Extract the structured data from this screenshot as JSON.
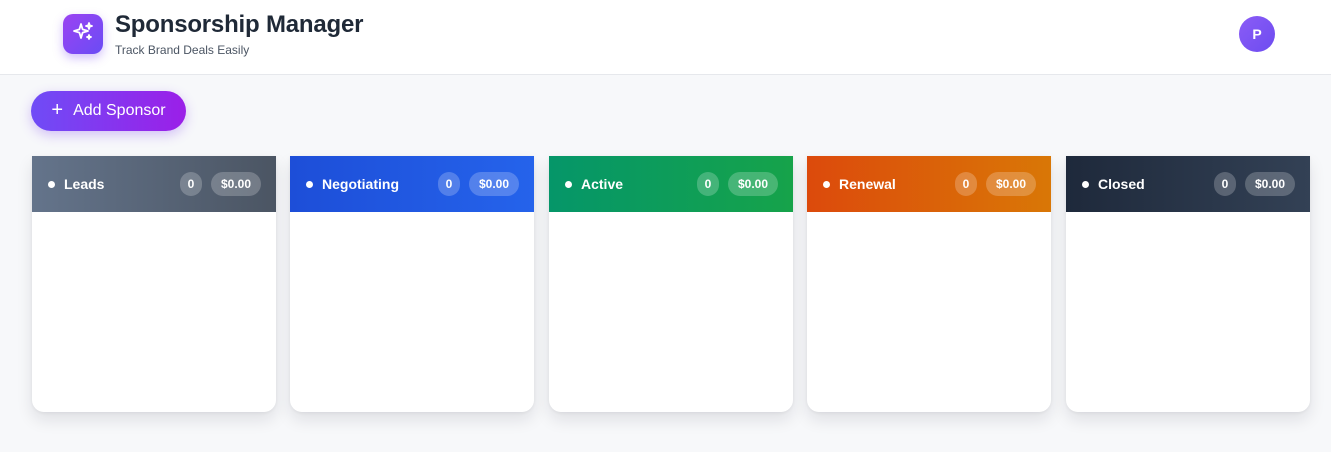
{
  "header": {
    "title": "Sponsorship Manager",
    "subtitle": "Track Brand Deals Easily",
    "logo_icon": "sparkles-icon",
    "avatar_initial": "P"
  },
  "toolbar": {
    "add_label": "Add Sponsor",
    "add_icon": "plus-icon"
  },
  "columns": [
    {
      "id": "leads",
      "title": "Leads",
      "count": "0",
      "total": "$0.00",
      "gradient": [
        "#4b5563",
        "#64748b"
      ]
    },
    {
      "id": "negotiating",
      "title": "Negotiating",
      "count": "0",
      "total": "$0.00",
      "gradient": [
        "#2563eb",
        "#1d4ed8"
      ]
    },
    {
      "id": "active",
      "title": "Active",
      "count": "0",
      "total": "$0.00",
      "gradient": [
        "#16a34a",
        "#059669"
      ]
    },
    {
      "id": "renewal",
      "title": "Renewal",
      "count": "0",
      "total": "$0.00",
      "gradient": [
        "#d97706",
        "#dc4a0c"
      ]
    },
    {
      "id": "closed",
      "title": "Closed",
      "count": "0",
      "total": "$0.00",
      "gradient": [
        "#334155",
        "#1e293b"
      ]
    }
  ],
  "colors": {
    "accent_start": "#6f4cf6",
    "accent_end": "#9b1fe8"
  }
}
